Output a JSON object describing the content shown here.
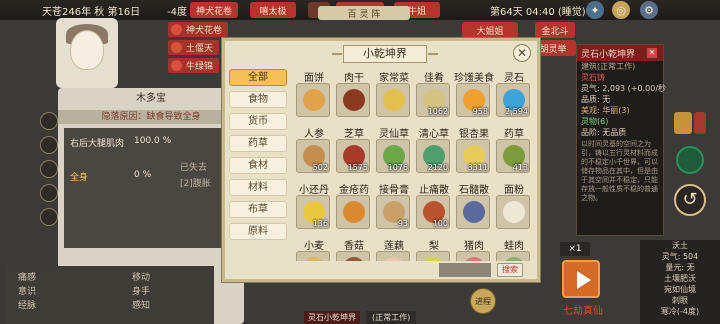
{
  "topbar": {
    "date": "天苍246年 秋 第16日",
    "temperature": "-4度",
    "time_status": "第64天 04:40 (睡觉)",
    "center_banner": "百 灵 阵",
    "badges": [
      "神犬花卷",
      "嘻太极",
      "熊宏一",
      "牛姐",
      "大姐姐",
      "金北斗"
    ]
  },
  "background": {
    "left_badges": [
      "土偃天",
      "牛绿锦"
    ],
    "left_panel": {
      "title": "木多宝",
      "subtitle": "隐落原因：缺食导致全身",
      "rows": [
        {
          "label": "右后大腿肌肉",
          "value": "100.0 %"
        },
        {
          "label": "全身",
          "value": "0 %"
        }
      ],
      "status_tags": [
        "已失去",
        "[2]腹胀"
      ],
      "stats": [
        "痛感",
        "意识",
        "经脉",
        "移动",
        "身手",
        "感知"
      ]
    },
    "right_badge": "胡灵举",
    "bottom_tag_a": "灵石小乾坤界",
    "bottom_tag_b": "(正常工作)",
    "zen_button": "进程"
  },
  "right_panel": {
    "title": "灵石小乾坤界",
    "subtitle": "建筑(正常工作)",
    "lines": [
      {
        "text": "灵石铸",
        "tone": "red"
      },
      {
        "text": "灵气: 2,093 (+0.00/秒",
        "tone": ""
      },
      {
        "text": "品质: 无",
        "tone": ""
      },
      {
        "text": "美观: 华丽(3)",
        "tone": "gold"
      },
      {
        "text": "灵物(6)",
        "tone": "green"
      },
      {
        "text": "品阶: 无品质",
        "tone": ""
      }
    ],
    "note": "以时间灵基的空间之为引，铸以五行灵材料而成的不稳定小千世界，可以储存物品在其中，但是由于其空间并不稳定，只能存放一般性质不稳的普通之物。"
  },
  "right_info": {
    "lines": [
      "沃土",
      "灵气: 504",
      "量元: 无",
      "土壤肥沃",
      "宛如仙境",
      "刺眼",
      "寒冷(-4度)"
    ]
  },
  "seven_kill": {
    "multiplier": "×1",
    "label": "七劫真仙"
  },
  "modal": {
    "title": "小乾坤界",
    "close_glyph": "✕",
    "categories": [
      "全部",
      "食物",
      "货币",
      "药草",
      "食材",
      "材料",
      "布草",
      "原料"
    ],
    "active_category": 0,
    "items": [
      {
        "name": "面饼",
        "qty": "",
        "color": "#e0a24a"
      },
      {
        "name": "肉干",
        "qty": "",
        "color": "#8a3a22"
      },
      {
        "name": "家常菜",
        "qty": "",
        "color": "#e2c04e"
      },
      {
        "name": "佳肴",
        "qty": "1062",
        "color": "#d3c380"
      },
      {
        "name": "珍馐美食",
        "qty": "958",
        "color": "#f0a030"
      },
      {
        "name": "灵石",
        "qty": "2,594",
        "color": "#3ea3d6"
      },
      {
        "name": "人参",
        "qty": "502",
        "color": "#c68e4e"
      },
      {
        "name": "芝草",
        "qty": "1575",
        "color": "#a63b2a"
      },
      {
        "name": "灵仙草",
        "qty": "1076",
        "color": "#6aa84a"
      },
      {
        "name": "清心草",
        "qty": "2120",
        "color": "#4fa06e"
      },
      {
        "name": "银杏果",
        "qty": "3311",
        "color": "#e6cd5a"
      },
      {
        "name": "药草",
        "qty": "413",
        "color": "#7d9a3c"
      },
      {
        "name": "小还丹",
        "qty": "136",
        "color": "#e9c840"
      },
      {
        "name": "金疮药",
        "qty": "",
        "color": "#d98a2e"
      },
      {
        "name": "接骨膏",
        "qty": "93",
        "color": "#c8a068"
      },
      {
        "name": "止痛散",
        "qty": "100",
        "color": "#b9542e"
      },
      {
        "name": "石髓散",
        "qty": "",
        "color": "#5a6a9c"
      },
      {
        "name": "面粉",
        "qty": "",
        "color": "#efe8d6"
      },
      {
        "name": "小麦",
        "qty": "",
        "color": "#d8b864"
      },
      {
        "name": "香菇",
        "qty": "",
        "color": "#8d5a3a"
      },
      {
        "name": "莲藕",
        "qty": "",
        "color": "#e8c8b0"
      },
      {
        "name": "梨",
        "qty": "",
        "color": "#d8d05a"
      },
      {
        "name": "猪肉",
        "qty": "",
        "color": "#d87a74"
      },
      {
        "name": "蛙肉",
        "qty": "",
        "color": "#8ab070"
      }
    ],
    "search_placeholder": "",
    "search_label": "搜索"
  },
  "colors": {
    "accent": "#b5352c",
    "active_tab": "#f2c15a",
    "modal_bg": "#e9e0c8"
  }
}
